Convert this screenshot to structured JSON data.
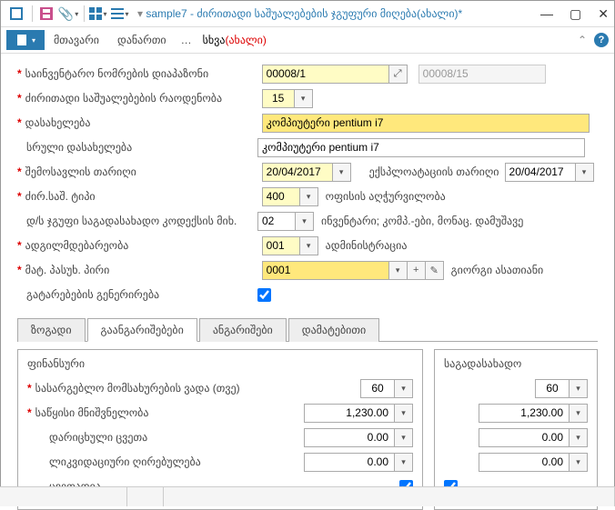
{
  "title": "sample7 - ძირითადი საშუალებების ჯგუფური მიღება(ახალი)*",
  "menu": {
    "main": "მთავარი",
    "attach": "დანართი",
    "other": "სხვა",
    "new": "(ახალი)"
  },
  "labels": {
    "inv_range": "საინვენტარო ნომრების დიაპაზონი",
    "qty": "ძირითადი საშუალებების რაოდენობა",
    "name": "დასახელება",
    "full_name": "სრული დასახელება",
    "income_date": "შემოსავლის თარიღი",
    "exploit_date": "ექსპლოატაციის თარიღი",
    "asset_type": "ძირ.საშ. ტიპი",
    "tax_group": "დ/ს ჯგუფი საგადასახადო კოდექსის მიხ.",
    "location": "ადგილმდებარეობა",
    "resp_person": "მატ. პასუხ. პირი",
    "gen_postings": "გატარებების გენერირება"
  },
  "fields": {
    "inv_from": "00008/1",
    "inv_to": "00008/15",
    "qty": "15",
    "name": "კომპიუტერი pentium i7",
    "full_name": "კომპიუტერი pentium i7",
    "income_date": "20/04/2017",
    "exploit_date": "20/04/2017",
    "asset_type_code": "400",
    "asset_type_text": "ოფისის აღჭურვილობა",
    "tax_group_code": "02",
    "tax_group_text": "ინვენტარი; კომპ.-ები, მონაც. დამუშავე",
    "location_code": "001",
    "location_text": "ადმინისტრაცია",
    "person_code": "0001",
    "person_text": "გიორგი ასათიანი"
  },
  "tabs": {
    "general": "ზოგადი",
    "calculations": "გაანგარიშებები",
    "accounts": "ანგარიშები",
    "additional": "დამატებითი"
  },
  "panel": {
    "fin_title": "ფინანსური",
    "tax_title": "საგადასახადო",
    "useful_life": "სასარგებლო მომსახურების ვადა (თვე)",
    "initial_value": "საწყისი მნიშვნელობა",
    "acc_dep": "დარიცხული ცვეთა",
    "liq_value": "ლიკვიდაციური ღირებულება",
    "depreciable": "ცვეთადია",
    "fin": {
      "months": "60",
      "initial": "1,230.00",
      "acc_dep": "0.00",
      "liq": "0.00"
    },
    "tax": {
      "months": "60",
      "initial": "1,230.00",
      "acc_dep": "0.00",
      "liq": "0.00"
    }
  }
}
